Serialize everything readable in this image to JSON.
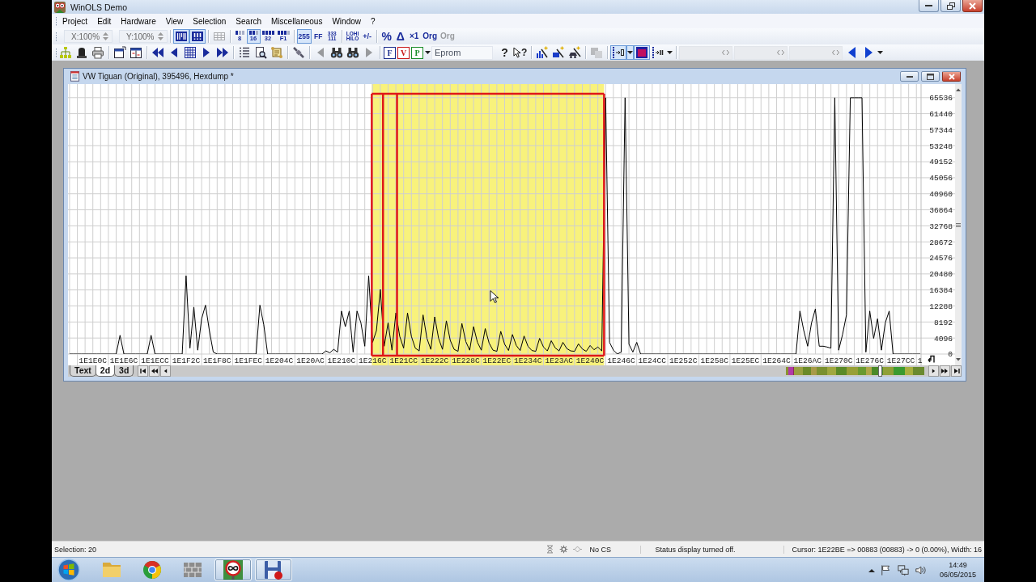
{
  "window": {
    "title": "WinOLS Demo"
  },
  "menu": [
    "Project",
    "Edit",
    "Hardware",
    "View",
    "Selection",
    "Search",
    "Miscellaneous",
    "Window",
    "?"
  ],
  "toolbar_1": {
    "x_zoom": "X:100%",
    "y_zoom": "Y:100%",
    "buttons": [
      {
        "kind": "icon",
        "selected": true,
        "disabled": false
      },
      {
        "kind": "icon",
        "selected": true,
        "disabled": false
      },
      {
        "kind": "icon",
        "selected": false,
        "disabled": true
      },
      {
        "kind": "bits",
        "label": "8",
        "selected": false,
        "disabled": false
      },
      {
        "kind": "bits",
        "label": "16",
        "selected": true,
        "disabled": false
      },
      {
        "kind": "bits",
        "label": "32",
        "selected": false,
        "disabled": false
      },
      {
        "kind": "bits",
        "label": "F1",
        "selected": false,
        "disabled": false
      },
      {
        "kind": "text",
        "label": "255",
        "selected": true,
        "disabled": false
      },
      {
        "kind": "text",
        "label": "FF",
        "selected": false,
        "disabled": false
      },
      {
        "kind": "stacked",
        "top_label": "333",
        "label": "111",
        "selected": false,
        "disabled": false
      },
      {
        "kind": "stacked",
        "top_label": "LOHI",
        "label": "HILO",
        "selected": false,
        "disabled": false
      },
      {
        "kind": "text",
        "label": "+/-",
        "selected": false,
        "disabled": false
      },
      {
        "kind": "text",
        "label": "%",
        "selected": false,
        "disabled": false
      },
      {
        "kind": "text",
        "label": "Δ",
        "selected": false,
        "disabled": false
      },
      {
        "kind": "text",
        "label": "×1",
        "selected": false,
        "disabled": false
      },
      {
        "kind": "text",
        "label": "Org",
        "selected": false,
        "disabled": false
      },
      {
        "kind": "text",
        "label": "Org",
        "selected": false,
        "disabled": true
      }
    ]
  },
  "toolbar_2": {
    "buttons": [
      {
        "kind": "icon",
        "selected": false,
        "disabled": false
      },
      {
        "kind": "icon",
        "selected": false,
        "disabled": false
      },
      {
        "kind": "icon",
        "selected": false,
        "disabled": false
      },
      {
        "kind": "icon",
        "selected": false,
        "disabled": false
      },
      {
        "kind": "icon",
        "selected": false,
        "disabled": false
      },
      {
        "kind": "icon",
        "selected": false,
        "disabled": false
      },
      {
        "kind": "icon",
        "selected": false,
        "disabled": false
      },
      {
        "kind": "icon",
        "selected": false,
        "disabled": false
      },
      {
        "kind": "icon",
        "selected": false,
        "disabled": false
      },
      {
        "kind": "icon",
        "selected": false,
        "disabled": false
      },
      {
        "kind": "icon",
        "selected": false,
        "disabled": false
      },
      {
        "kind": "icon",
        "selected": false,
        "disabled": false
      },
      {
        "kind": "icon",
        "selected": false,
        "disabled": false
      },
      {
        "kind": "icon",
        "selected": false,
        "disabled": false
      },
      {
        "kind": "icon",
        "selected": false,
        "disabled": true
      },
      {
        "kind": "icon",
        "selected": false,
        "disabled": false
      },
      {
        "kind": "icon",
        "selected": false,
        "disabled": false
      },
      {
        "kind": "icon",
        "selected": false,
        "disabled": true
      },
      {
        "kind": "letter",
        "label": "F",
        "color": "#1a2c8c",
        "selected": false,
        "disabled": false
      },
      {
        "kind": "letter",
        "label": "V",
        "color": "#c81818",
        "selected": false,
        "disabled": false
      },
      {
        "kind": "letter",
        "label": "P",
        "color": "#188c28",
        "selected": false,
        "disabled": false
      },
      {
        "kind": "caret",
        "selected": false,
        "disabled": false
      },
      {
        "kind": "dropdown",
        "value": "Eprom",
        "selected": false,
        "disabled": false
      },
      {
        "kind": "help",
        "label": "?",
        "selected": false,
        "disabled": false
      },
      {
        "kind": "pointer-help",
        "label": "?",
        "selected": false,
        "disabled": false
      },
      {
        "kind": "icon",
        "selected": false,
        "disabled": false
      },
      {
        "kind": "icon",
        "selected": false,
        "disabled": false
      },
      {
        "kind": "icon",
        "selected": false,
        "disabled": false
      },
      {
        "kind": "icon",
        "selected": false,
        "disabled": true
      },
      {
        "kind": "icon",
        "selected": true,
        "disabled": false
      },
      {
        "kind": "caret",
        "selected": true,
        "disabled": false
      },
      {
        "kind": "icon",
        "selected": true,
        "disabled": false
      },
      {
        "kind": "icon",
        "selected": false,
        "disabled": false
      },
      {
        "kind": "caret",
        "selected": false,
        "disabled": false
      },
      {
        "kind": "field",
        "selected": false,
        "disabled": true
      },
      {
        "kind": "field",
        "selected": false,
        "disabled": true
      },
      {
        "kind": "field",
        "selected": false,
        "disabled": true
      },
      {
        "kind": "icon",
        "selected": false,
        "disabled": false
      },
      {
        "kind": "icon",
        "selected": false,
        "disabled": false
      },
      {
        "kind": "caret",
        "selected": false,
        "disabled": false
      }
    ]
  },
  "document": {
    "title": "VW Tiguan (Original), 395496, Hexdump *",
    "chart_data": {
      "type": "line",
      "grid": true,
      "ylim": [
        0,
        69000
      ],
      "categories": [
        null,
        null,
        null,
        null,
        null,
        null,
        "1E1E0C",
        null,
        null,
        null,
        null,
        null,
        null,
        null,
        "1E1E6C",
        null,
        null,
        null,
        null,
        null,
        null,
        null,
        "1E1ECC",
        null,
        null,
        null,
        null,
        null,
        null,
        null,
        "1E1F2C",
        null,
        null,
        null,
        null,
        null,
        null,
        null,
        "1E1F8C",
        null,
        null,
        null,
        null,
        null,
        null,
        null,
        "1E1FEC",
        null,
        null,
        null,
        null,
        null,
        null,
        null,
        "1E204C",
        null,
        null,
        null,
        null,
        null,
        null,
        null,
        "1E20AC",
        null,
        null,
        null,
        null,
        null,
        null,
        null,
        "1E210C",
        null,
        null,
        null,
        null,
        null,
        null,
        null,
        "1E216C",
        null,
        null,
        null,
        null,
        null,
        null,
        null,
        "1E21CC",
        null,
        null,
        null,
        null,
        null,
        null,
        null,
        "1E222C",
        null,
        null,
        null,
        null,
        null,
        null,
        null,
        "1E228C",
        null,
        null,
        null,
        null,
        null,
        null,
        null,
        "1E22EC",
        null,
        null,
        null,
        null,
        null,
        null,
        null,
        "1E234C",
        null,
        null,
        null,
        null,
        null,
        null,
        null,
        "1E23AC",
        null,
        null,
        null,
        null,
        null,
        null,
        null,
        "1E240C",
        null,
        null,
        null,
        null,
        null,
        null,
        null,
        "1E246C",
        null,
        null,
        null,
        null,
        null,
        null,
        null,
        "1E24CC",
        null,
        null,
        null,
        null,
        null,
        null,
        null,
        "1E252C",
        null,
        null,
        null,
        null,
        null,
        null,
        null,
        "1E258C",
        null,
        null,
        null,
        null,
        null,
        null,
        null,
        "1E25EC",
        null,
        null,
        null,
        null,
        null,
        null,
        null,
        "1E264C",
        null,
        null,
        null,
        null,
        null,
        null,
        null,
        "1E26AC",
        null,
        null,
        null,
        null,
        null,
        null,
        null,
        "1E270C",
        null,
        null,
        null,
        null,
        null,
        null,
        null,
        "1E276C",
        null,
        null,
        null,
        null,
        null,
        null,
        null,
        "1E27CC",
        null,
        null,
        null,
        null,
        null
      ],
      "yticks": [
        0,
        4096,
        8192,
        12288,
        16384,
        20480,
        24576,
        28672,
        32768,
        36864,
        40960,
        45056,
        49152,
        53248,
        57344,
        61440,
        65536
      ],
      "series": [
        {
          "color": "#000000",
          "values": [
            0,
            0,
            0,
            0,
            0,
            0,
            0,
            0,
            0,
            0,
            0,
            0,
            0,
            4800,
            0,
            0,
            0,
            0,
            0,
            0,
            0,
            4800,
            0,
            0,
            0,
            0,
            0,
            0,
            0,
            0,
            20000,
            1500,
            12000,
            1000,
            9000,
            12500,
            6000,
            500,
            0,
            0,
            0,
            0,
            0,
            0,
            0,
            0,
            0,
            0,
            0,
            12500,
            7500,
            0,
            0,
            0,
            0,
            0,
            0,
            0,
            0,
            0,
            0,
            0,
            0,
            0,
            0,
            0,
            800,
            300,
            1200,
            500,
            11000,
            7000,
            11000,
            500,
            11000,
            8000,
            2000,
            20000,
            3000,
            6000,
            16500,
            2000,
            8000,
            1000,
            10500,
            4500,
            1500,
            10500,
            4500,
            1500,
            800,
            10000,
            4000,
            1200,
            9500,
            4000,
            1200,
            8500,
            3500,
            1200,
            700,
            7800,
            3200,
            1000,
            7000,
            3000,
            1000,
            6500,
            2800,
            1000,
            700,
            5800,
            2500,
            900,
            5000,
            2200,
            900,
            4600,
            2000,
            900,
            700,
            4000,
            1800,
            800,
            3400,
            1600,
            800,
            3000,
            1400,
            800,
            700,
            2600,
            1300,
            700,
            2200,
            1100,
            1800,
            800,
            65500,
            3000,
            1000,
            0,
            500,
            65500,
            2500,
            500,
            3000,
            0,
            0,
            0,
            0,
            0,
            0,
            0,
            0,
            0,
            0,
            0,
            0,
            0,
            0,
            0,
            0,
            0,
            0,
            0,
            0,
            0,
            0,
            0,
            0,
            0,
            0,
            0,
            0,
            0,
            0,
            0,
            0,
            0,
            0,
            0,
            0,
            0,
            0,
            0,
            0,
            0,
            11000,
            6000,
            2000,
            8000,
            11500,
            2000,
            2000,
            1800,
            1500,
            65500,
            1000,
            5000,
            10000,
            65500,
            65500,
            65500,
            65500,
            500,
            11000,
            4000,
            9000,
            1000,
            8000,
            11000,
            0,
            0,
            0,
            0,
            0,
            0,
            0,
            0
          ]
        }
      ]
    },
    "cut_axis_label": "1",
    "tabs": [
      {
        "label": "Text",
        "selected": false
      },
      {
        "label": "2d",
        "selected": true
      },
      {
        "label": "3d",
        "selected": false
      }
    ]
  },
  "status_bar": {
    "selection": "Selection: 20",
    "checksum": "No CS",
    "message": "Status display turned off.",
    "cursor": "Cursor: 1E22BE => 00883 (00883) -> 0 (0.00%), Width: 16"
  },
  "taskbar": {
    "apps": [
      {
        "running": false
      },
      {
        "running": false
      },
      {
        "running": false
      },
      {
        "running": true
      },
      {
        "running": true
      }
    ],
    "time": "14:49",
    "date": "06/05/2015"
  }
}
